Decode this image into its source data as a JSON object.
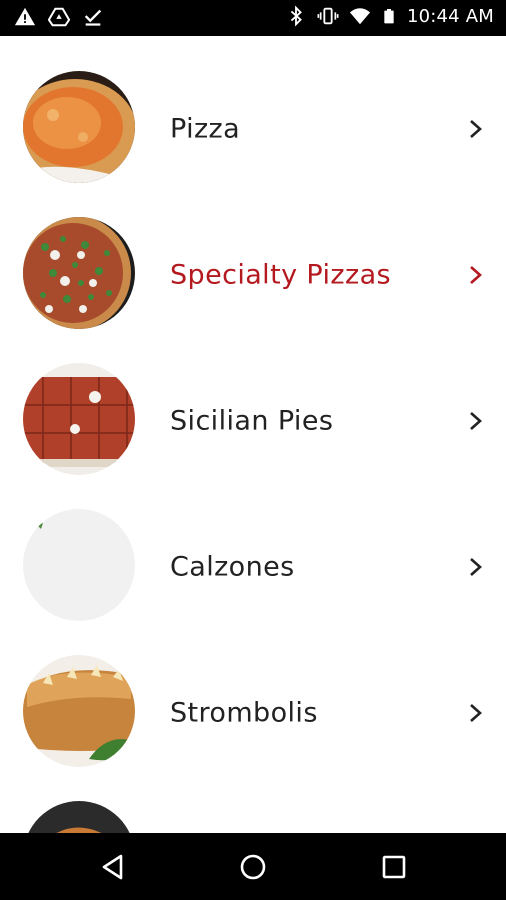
{
  "status_bar": {
    "time": "10:44 AM",
    "left_icons": [
      "warning-icon",
      "drive-icon",
      "download-done-icon"
    ],
    "right_icons": [
      "bluetooth-icon",
      "vibrate-icon",
      "wifi-icon",
      "battery-icon"
    ]
  },
  "menu": {
    "items": [
      {
        "label": "Pizza",
        "active": false,
        "icon": "chevron-right-icon"
      },
      {
        "label": "Specialty Pizzas",
        "active": true,
        "icon": "chevron-right-icon"
      },
      {
        "label": "Sicilian Pies",
        "active": false,
        "icon": "chevron-right-icon"
      },
      {
        "label": "Calzones",
        "active": false,
        "icon": "chevron-right-icon"
      },
      {
        "label": "Strombolis",
        "active": false,
        "icon": "chevron-right-icon"
      }
    ]
  },
  "colors": {
    "accent": "#b3191f",
    "text": "#222222",
    "system_bar": "#000000"
  },
  "nav_bar": {
    "buttons": [
      "back-icon",
      "home-icon",
      "recents-icon"
    ]
  }
}
